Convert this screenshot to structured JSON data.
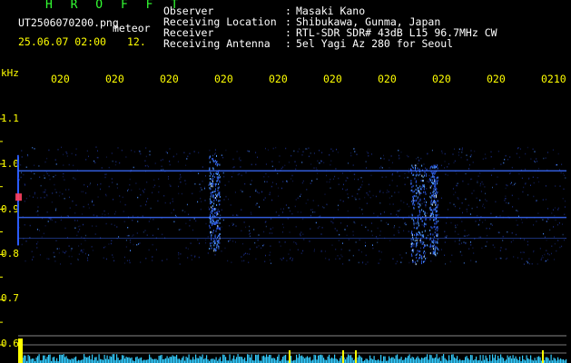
{
  "header": {
    "title": "H R O F F T",
    "filename": "UT2506070200.png",
    "tag": "meteor",
    "datetime": "25.06.07 02:00",
    "count": "12."
  },
  "metadata": [
    {
      "label": "Observer",
      "value": "Masaki Kano"
    },
    {
      "label": "Receiving Location",
      "value": "Shibukawa, Gunma, Japan"
    },
    {
      "label": "Receiver",
      "value": "RTL-SDR SDR# 43dB L15 96.7MHz CW"
    },
    {
      "label": "Receiving Antenna",
      "value": "5el Yagi Az 280 for Seoul"
    }
  ],
  "axis": {
    "y_unit": "kHz",
    "y_ticks": [
      "1.1",
      "1.0",
      "0.9",
      "0.8",
      "0.7",
      "0.6"
    ],
    "x_ticks": [
      "020",
      "020",
      "020",
      "020",
      "020",
      "020",
      "020",
      "020",
      "020",
      "0210"
    ]
  },
  "colors": {
    "background": "#000000",
    "text_primary": "#ffff00",
    "title": "#33ff33",
    "signal": "#3a6cff",
    "hot_signal": "#ff4060",
    "level_bar": "#33ccff",
    "level_peak": "#ffff00"
  },
  "chart_data": {
    "type": "heatmap",
    "ylim": [
      0.58,
      1.15
    ],
    "carrier_lines_khz": [
      0.985,
      0.882,
      0.836
    ],
    "meteor_bursts": [
      {
        "x_min": 3.5,
        "width_min": 0.2,
        "khz_min": 0.81,
        "khz_max": 1.02,
        "intensity": 0.9
      },
      {
        "x_min": 7.2,
        "width_min": 0.3,
        "khz_min": 0.78,
        "khz_max": 1.0,
        "intensity": 0.9
      },
      {
        "x_min": 7.55,
        "width_min": 0.15,
        "khz_min": 0.8,
        "khz_max": 1.0,
        "intensity": 0.8
      }
    ]
  }
}
